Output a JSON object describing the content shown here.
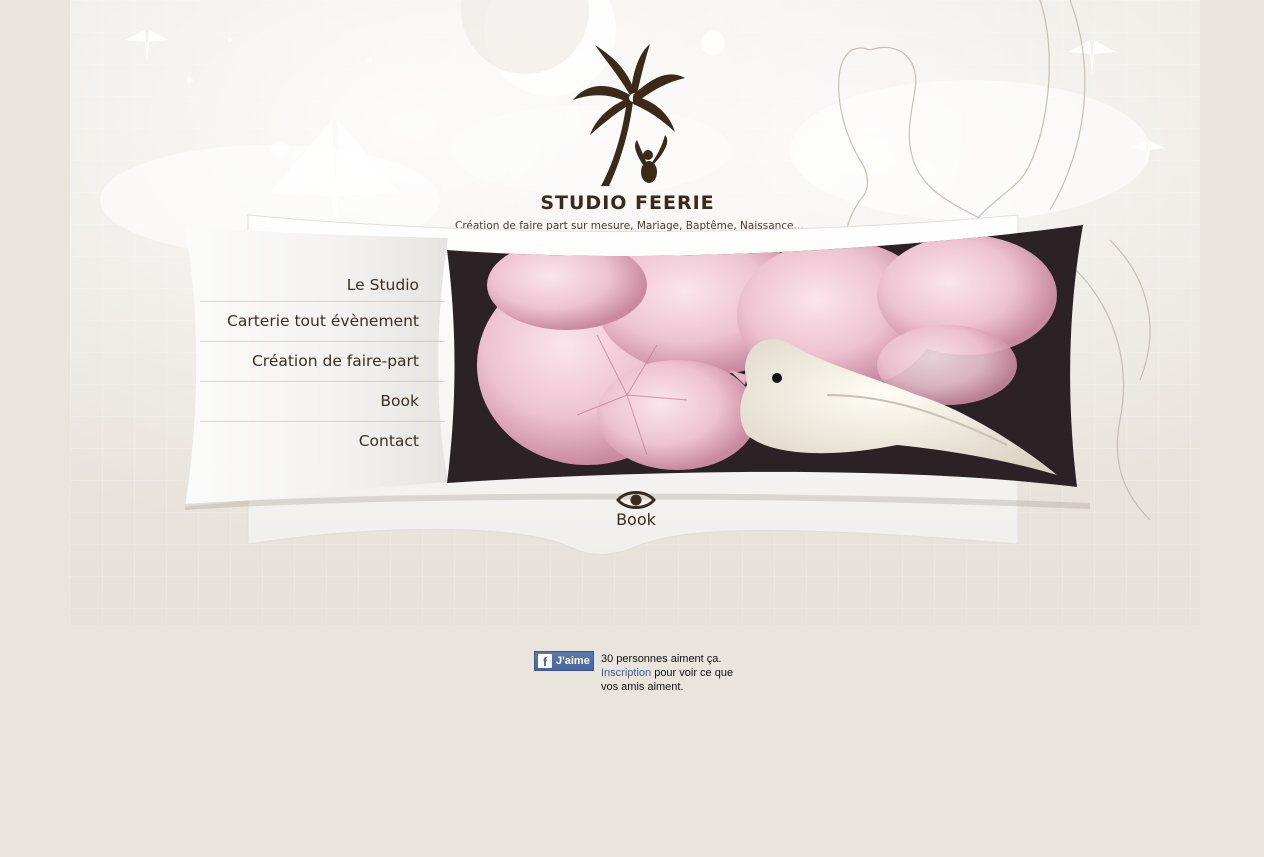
{
  "brand": {
    "name": "STUDIO FEERIE",
    "tagline": "Création de faire part sur mesure, Mariage, Baptême, Naissance..."
  },
  "menu": {
    "items": [
      {
        "label": "Le Studio"
      },
      {
        "label": "Carterie tout évènement"
      },
      {
        "label": "Création de faire-part"
      },
      {
        "label": "Book"
      },
      {
        "label": "Contact"
      }
    ]
  },
  "book_tab": {
    "label": "Book",
    "icon": "eye-icon"
  },
  "facebook": {
    "like_label": "J'aime",
    "count_text": "30 personnes aiment ça.",
    "signup_link": "Inscription",
    "signup_text": " pour voir ce que vos amis aiment."
  },
  "colors": {
    "background": "#e9e5dd",
    "brand_brown": "#3b2a17",
    "facebook_blue": "#3b5998"
  }
}
